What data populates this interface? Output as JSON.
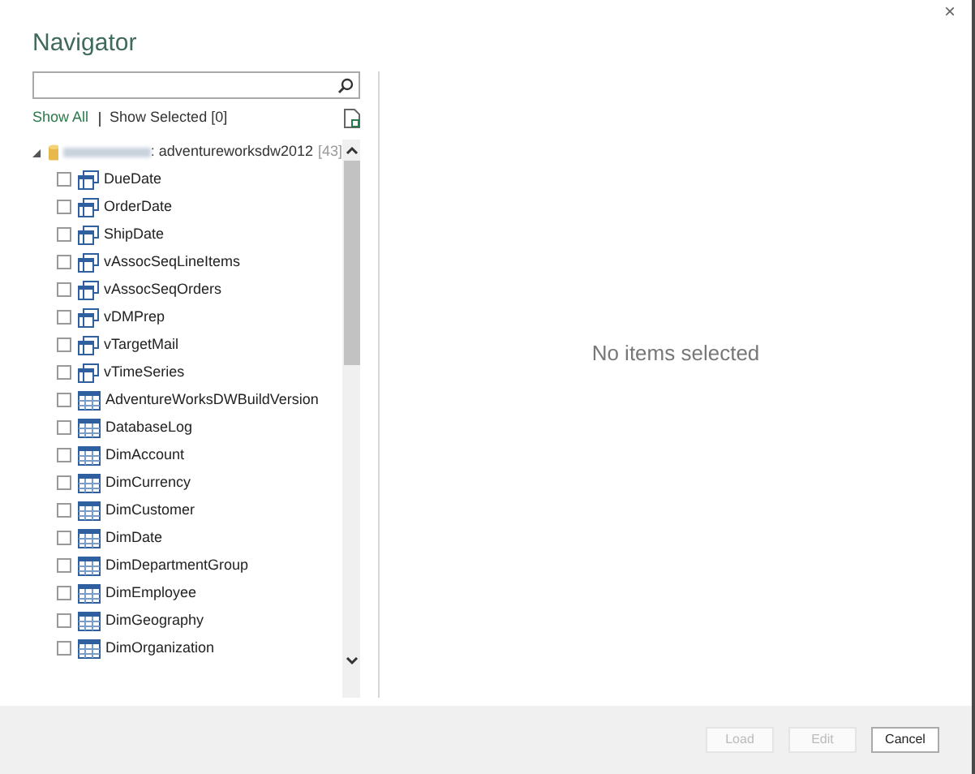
{
  "window": {
    "title": "Navigator",
    "close": "×"
  },
  "filters": [
    {
      "label": "Show All",
      "selected": true
    },
    {
      "label": "Show Selected [0]",
      "selected": false
    }
  ],
  "tree": {
    "label": ": adventureworksdw2012",
    "count": "[43]",
    "expanded": true,
    "children": [
      {
        "label": "DueDate",
        "kind": "view",
        "checked": false
      },
      {
        "label": "OrderDate",
        "kind": "view",
        "checked": false
      },
      {
        "label": "ShipDate",
        "kind": "view",
        "checked": false
      },
      {
        "label": "vAssocSeqLineItems",
        "kind": "view",
        "checked": false
      },
      {
        "label": "vAssocSeqOrders",
        "kind": "view",
        "checked": false
      },
      {
        "label": "vDMPrep",
        "kind": "view",
        "checked": false
      },
      {
        "label": "vTargetMail",
        "kind": "view",
        "checked": false
      },
      {
        "label": "vTimeSeries",
        "kind": "view",
        "checked": false
      },
      {
        "label": "AdventureWorksDWBuildVersion",
        "kind": "table",
        "checked": false
      },
      {
        "label": "DatabaseLog",
        "kind": "table",
        "checked": false
      },
      {
        "label": "DimAccount",
        "kind": "table",
        "checked": false
      },
      {
        "label": "DimCurrency",
        "kind": "table",
        "checked": false
      },
      {
        "label": "DimCustomer",
        "kind": "table",
        "checked": false
      },
      {
        "label": "DimDate",
        "kind": "table",
        "checked": false
      },
      {
        "label": "DimDepartmentGroup",
        "kind": "table",
        "checked": false
      },
      {
        "label": "DimEmployee",
        "kind": "table",
        "checked": false
      },
      {
        "label": "DimGeography",
        "kind": "table",
        "checked": false
      },
      {
        "label": "DimOrganization",
        "kind": "table",
        "checked": false
      }
    ]
  },
  "preview": {
    "message": "No items selected"
  },
  "buttons": [
    {
      "label": "Load",
      "disabled": true
    },
    {
      "label": "Edit",
      "disabled": true
    },
    {
      "label": "Cancel",
      "disabled": false
    }
  ]
}
